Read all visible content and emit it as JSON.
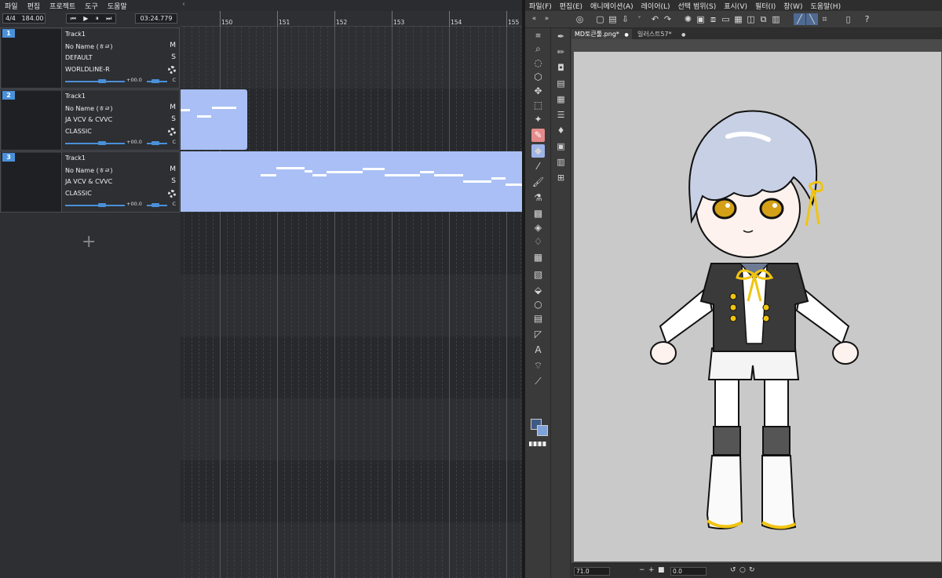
{
  "left_app": {
    "menu": [
      "파일",
      "편집",
      "프로젝트",
      "도구",
      "도움말"
    ],
    "collapse_icon": "chevron-left-icon",
    "transport": {
      "time_signature": "4/4",
      "bpm": "184.00",
      "time": "03:24.779",
      "buttons": [
        "skip-back-icon",
        "play-icon",
        "pause-icon",
        "skip-forward-icon"
      ]
    },
    "ruler_measures": [
      "150",
      "151",
      "152",
      "153",
      "154",
      "155"
    ],
    "tracks": [
      {
        "number": "1",
        "name": "Track1",
        "singer": "No Name (ㅎㄹ)",
        "phonemizer": "DEFAULT",
        "renderer": "WORLDLINE-R",
        "mute": "M",
        "solo": "S",
        "volume": "+00.0",
        "pan": "C"
      },
      {
        "number": "2",
        "name": "Track1",
        "singer": "No Name (ㅎㄹ)",
        "phonemizer": "JA VCV & CVVC",
        "renderer": "CLASSIC",
        "mute": "M",
        "solo": "S",
        "volume": "+00.0",
        "pan": "C"
      },
      {
        "number": "3",
        "name": "Track1",
        "singer": "No Name (ㅎㄹ)",
        "phonemizer": "JA VCV & CVVC",
        "renderer": "CLASSIC",
        "mute": "M",
        "solo": "S",
        "volume": "+00.0",
        "pan": "C"
      }
    ],
    "add_track_label": "+",
    "colors": {
      "part": "#a9bff5",
      "accent": "#4a90d9",
      "background": "#2d2f33"
    }
  },
  "right_app": {
    "menu": [
      "파일(F)",
      "편집(E)",
      "애니메이션(A)",
      "레이어(L)",
      "선택 범위(S)",
      "표시(V)",
      "필터(I)",
      "창(W)",
      "도움말(H)"
    ],
    "doc_tabs": [
      {
        "label": "MD토큰툴.png*",
        "close": "●"
      },
      {
        "label": "일러스트57*",
        "close": "●"
      }
    ],
    "tools_primary": [
      "grip-icon",
      "zoom-icon",
      "rotate-icon",
      "camera-icon",
      "move-icon",
      "auto-select-icon",
      "wand-icon",
      "pen-icon",
      "eraser-icon",
      "eyedropper-icon",
      "brush-icon",
      "airbrush-icon",
      "decoration-icon",
      "blend-icon",
      "water-icon",
      "ruler-icon",
      "gradient-icon",
      "fill-icon",
      "shape-icon",
      "frame-icon",
      "line-icon",
      "text-icon",
      "balloon-icon",
      "correct-line-icon"
    ],
    "tools_secondary": [
      "pen-sub-icon",
      "pencil-sub-icon",
      "marker-icon",
      "layer-icon",
      "pattern-icon",
      "stack-icon",
      "drop-icon",
      "film-icon",
      "tone-icon",
      "grid-icon"
    ],
    "status": {
      "zoom": "71.0",
      "angle": "0.0"
    },
    "colors": {
      "main": "#3f5a85",
      "sub": "#7fa3d8",
      "canvas": "#c9c9c9"
    }
  }
}
